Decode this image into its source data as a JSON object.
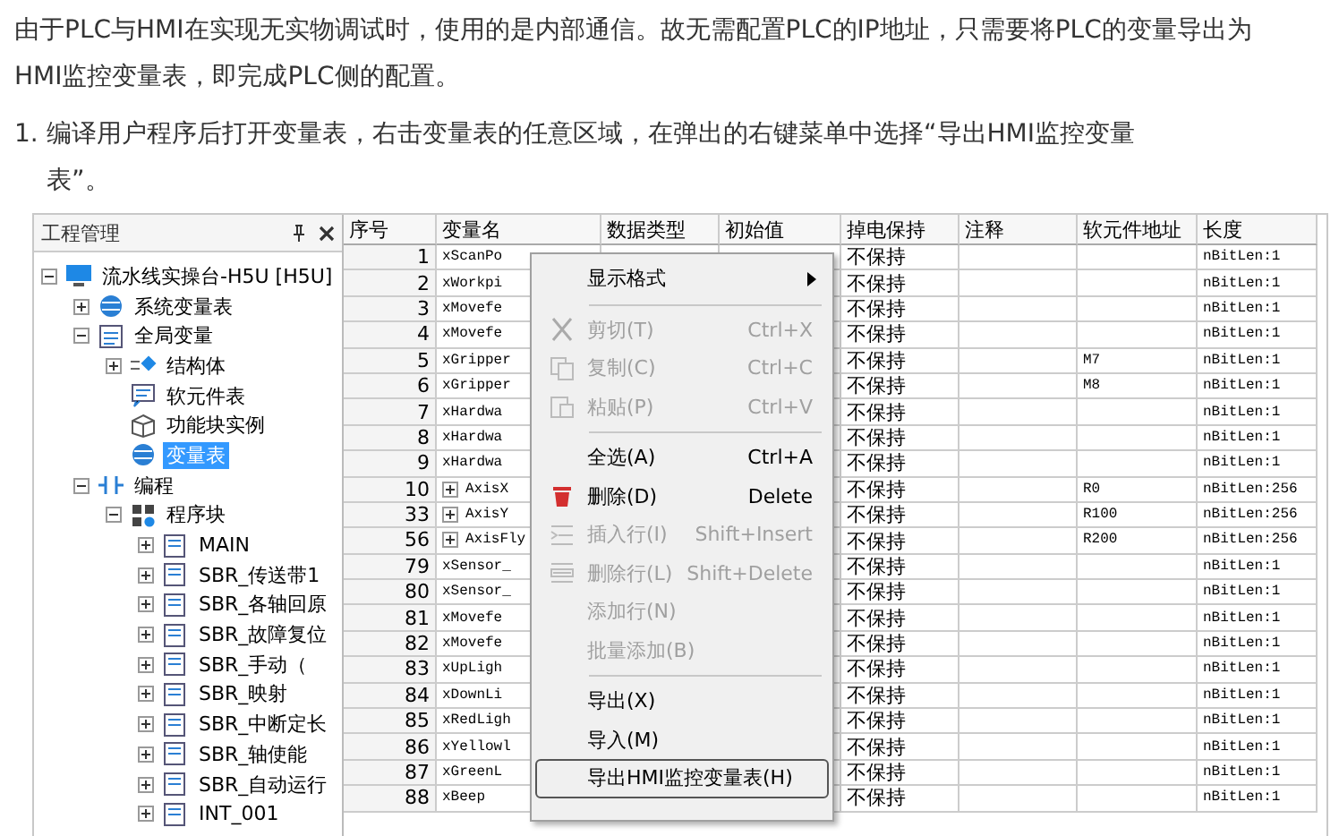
{
  "intro": "由于PLC与HMI在实现无实物调试时，使用的是内部通信。故无需配置PLC的IP地址，只需要将PLC的变量导出为HMI监控变量表，即完成PLC侧的配置。",
  "steps": [
    {
      "number": "1.",
      "text": "编译用户程序后打开变量表，右击变量表的任意区域，在弹出的右键菜单中选择“导出HMI监控变量表”。"
    }
  ],
  "project_panel": {
    "title": "工程管理",
    "tree": [
      {
        "label": "流水线实操台-H5U [H5U]",
        "kind": "device",
        "expanded": true,
        "selected": false,
        "children": [
          {
            "label": "系统变量表",
            "kind": "globe",
            "expanded": false,
            "selected": false
          },
          {
            "label": "全局变量",
            "kind": "sheet",
            "expanded": true,
            "selected": false,
            "children": [
              {
                "label": "结构体",
                "kind": "struct",
                "expanded": false,
                "selected": false
              },
              {
                "label": "软元件表",
                "kind": "note",
                "selected": false
              },
              {
                "label": "功能块实例",
                "kind": "cube",
                "selected": false
              },
              {
                "label": "变量表",
                "kind": "globe",
                "selected": true
              }
            ]
          },
          {
            "label": "编程",
            "kind": "ladder",
            "expanded": true,
            "selected": false,
            "children": [
              {
                "label": "程序块",
                "kind": "blocks",
                "expanded": true,
                "selected": false,
                "children": [
                  {
                    "label": "MAIN",
                    "kind": "program",
                    "expanded": false,
                    "selected": false
                  },
                  {
                    "label": "SBR_传送带1",
                    "kind": "program",
                    "expanded": false,
                    "selected": false
                  },
                  {
                    "label": "SBR_各轴回原",
                    "kind": "program",
                    "expanded": false,
                    "selected": false
                  },
                  {
                    "label": "SBR_故障复位",
                    "kind": "program",
                    "expanded": false,
                    "selected": false
                  },
                  {
                    "label": "SBR_手动（",
                    "kind": "program",
                    "expanded": false,
                    "selected": false
                  },
                  {
                    "label": "SBR_映射",
                    "kind": "program",
                    "expanded": false,
                    "selected": false
                  },
                  {
                    "label": "SBR_中断定长",
                    "kind": "program",
                    "expanded": false,
                    "selected": false
                  },
                  {
                    "label": "SBR_轴使能",
                    "kind": "program",
                    "expanded": false,
                    "selected": false
                  },
                  {
                    "label": "SBR_自动运行",
                    "kind": "program",
                    "expanded": false,
                    "selected": false
                  },
                  {
                    "label": "INT_001",
                    "kind": "program",
                    "expanded": false,
                    "selected": false
                  }
                ]
              }
            ]
          }
        ]
      }
    ]
  },
  "table": {
    "columns": [
      "序号",
      "变量名",
      "数据类型",
      "初始值",
      "掉电保持",
      "注释",
      "软元件地址",
      "长度"
    ],
    "rows": [
      {
        "no": "1",
        "name": "xScanPo",
        "kind": "var",
        "retain": "不保持",
        "address": "",
        "length": "nBitLen:1"
      },
      {
        "no": "2",
        "name": "xWorkpi",
        "kind": "var",
        "retain": "不保持",
        "address": "",
        "length": "nBitLen:1"
      },
      {
        "no": "3",
        "name": "xMovefe",
        "kind": "var",
        "retain": "不保持",
        "address": "",
        "length": "nBitLen:1"
      },
      {
        "no": "4",
        "name": "xMovefe",
        "kind": "var",
        "retain": "不保持",
        "address": "",
        "length": "nBitLen:1"
      },
      {
        "no": "5",
        "name": "xGripper",
        "kind": "var",
        "retain": "不保持",
        "address": "M7",
        "length": "nBitLen:1"
      },
      {
        "no": "6",
        "name": "xGripper",
        "kind": "var",
        "retain": "不保持",
        "address": "M8",
        "length": "nBitLen:1"
      },
      {
        "no": "7",
        "name": "xHardwa",
        "kind": "var",
        "retain": "不保持",
        "address": "",
        "length": "nBitLen:1"
      },
      {
        "no": "8",
        "name": "xHardwa",
        "kind": "var",
        "retain": "不保持",
        "address": "",
        "length": "nBitLen:1"
      },
      {
        "no": "9",
        "name": "xHardwa",
        "kind": "var",
        "retain": "不保持",
        "address": "",
        "length": "nBitLen:1"
      },
      {
        "no": "10",
        "name": "AxisX",
        "kind": "group",
        "retain": "不保持",
        "address": "R0",
        "length": "nBitLen:256"
      },
      {
        "no": "33",
        "name": "AxisY",
        "kind": "group",
        "retain": "不保持",
        "address": "R100",
        "length": "nBitLen:256"
      },
      {
        "no": "56",
        "name": "AxisFly",
        "kind": "group",
        "retain": "不保持",
        "address": "R200",
        "length": "nBitLen:256"
      },
      {
        "no": "79",
        "name": "xSensor_",
        "kind": "var",
        "retain": "不保持",
        "address": "",
        "length": "nBitLen:1"
      },
      {
        "no": "80",
        "name": "xSensor_",
        "kind": "var",
        "retain": "不保持",
        "address": "",
        "length": "nBitLen:1"
      },
      {
        "no": "81",
        "name": "xMovefe",
        "kind": "var",
        "retain": "不保持",
        "address": "",
        "length": "nBitLen:1"
      },
      {
        "no": "82",
        "name": "xMovefe",
        "kind": "var",
        "retain": "不保持",
        "address": "",
        "length": "nBitLen:1"
      },
      {
        "no": "83",
        "name": "xUpLigh",
        "kind": "var",
        "retain": "不保持",
        "address": "",
        "length": "nBitLen:1"
      },
      {
        "no": "84",
        "name": "xDownLi",
        "kind": "var",
        "retain": "不保持",
        "address": "",
        "length": "nBitLen:1"
      },
      {
        "no": "85",
        "name": "xRedLigh",
        "kind": "var",
        "retain": "不保持",
        "address": "",
        "length": "nBitLen:1"
      },
      {
        "no": "86",
        "name": "xYellowl",
        "kind": "var",
        "retain": "不保持",
        "address": "",
        "length": "nBitLen:1"
      },
      {
        "no": "87",
        "name": "xGreenL",
        "kind": "var",
        "retain": "不保持",
        "address": "",
        "length": "nBitLen:1"
      },
      {
        "no": "88",
        "name": "xBeep",
        "kind": "var",
        "retain": "不保持",
        "address": "",
        "length": "nBitLen:1"
      }
    ]
  },
  "context_menu": [
    {
      "kind": "submenu",
      "label": "显示格式",
      "disabled": false,
      "selected": false
    },
    {
      "kind": "separator"
    },
    {
      "kind": "cut",
      "label": "剪切(T)",
      "shortcut": "Ctrl+X",
      "disabled": true,
      "selected": false
    },
    {
      "kind": "copy",
      "label": "复制(C)",
      "shortcut": "Ctrl+C",
      "disabled": true,
      "selected": false
    },
    {
      "kind": "paste",
      "label": "粘贴(P)",
      "shortcut": "Ctrl+V",
      "disabled": true,
      "selected": false
    },
    {
      "kind": "separator"
    },
    {
      "kind": "plain",
      "label": "全选(A)",
      "shortcut": "Ctrl+A",
      "disabled": false,
      "selected": false
    },
    {
      "kind": "delete",
      "label": "删除(D)",
      "shortcut": "Delete",
      "disabled": false,
      "selected": false
    },
    {
      "kind": "insert_row",
      "label": "插入行(I)",
      "shortcut": "Shift+Insert",
      "disabled": true,
      "selected": false
    },
    {
      "kind": "delete_row",
      "label": "删除行(L)",
      "shortcut": "Shift+Delete",
      "disabled": true,
      "selected": false
    },
    {
      "kind": "plain",
      "label": "添加行(N)",
      "disabled": true,
      "selected": false
    },
    {
      "kind": "plain",
      "label": "批量添加(B)",
      "disabled": true,
      "selected": false
    },
    {
      "kind": "separator"
    },
    {
      "kind": "plain",
      "label": "导出(X)",
      "disabled": false,
      "selected": false
    },
    {
      "kind": "plain",
      "label": "导入(M)",
      "disabled": false,
      "selected": false
    },
    {
      "kind": "plain",
      "label": "导出HMI监控变量表(H)",
      "disabled": false,
      "selected": true
    }
  ]
}
